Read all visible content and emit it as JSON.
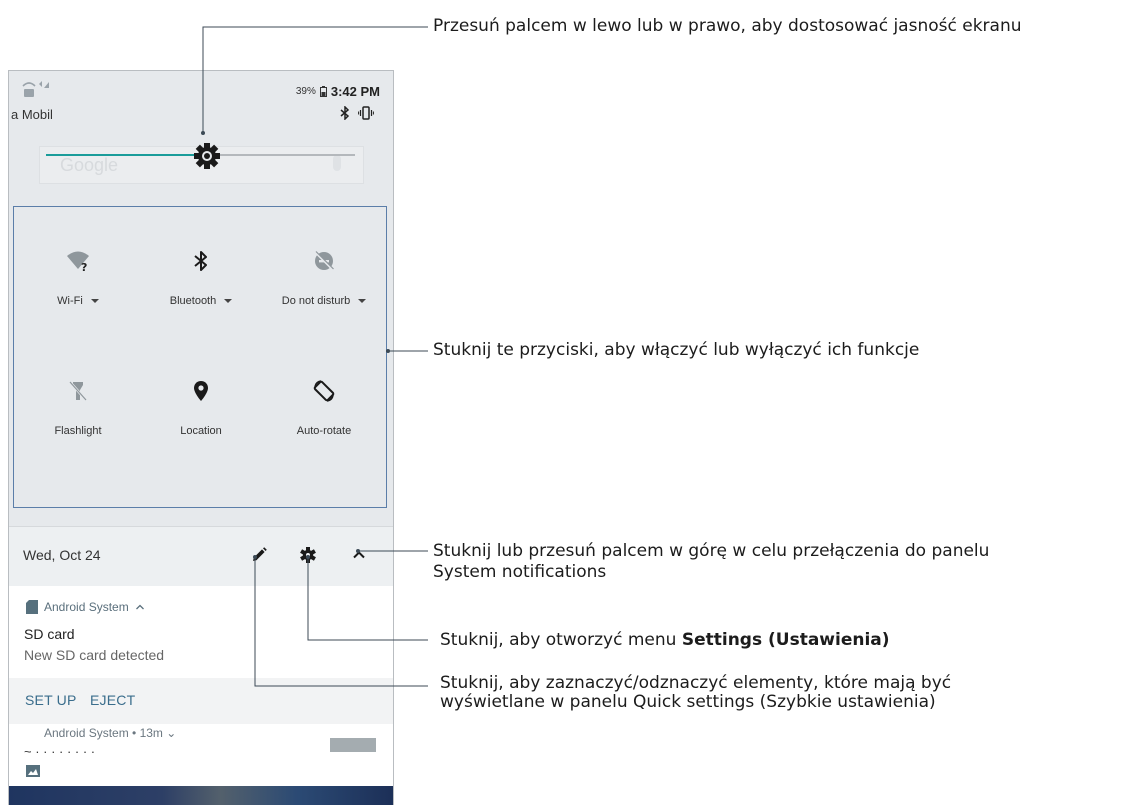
{
  "status_bar": {
    "carrier": "a Mobil",
    "battery": "39%",
    "time": "3:42 PM"
  },
  "search": {
    "ghost_text": "Google"
  },
  "brightness": {
    "level": 0.52
  },
  "quick_settings": {
    "tiles": [
      {
        "label": "Wi-Fi",
        "icon": "wifi-question-icon",
        "has_menu": true
      },
      {
        "label": "Bluetooth",
        "icon": "bluetooth-icon",
        "has_menu": true
      },
      {
        "label": "Do not disturb",
        "icon": "do-not-disturb-icon",
        "has_menu": true
      },
      {
        "label": "Flashlight",
        "icon": "flashlight-off-icon",
        "has_menu": false
      },
      {
        "label": "Location",
        "icon": "location-pin-icon",
        "has_menu": false
      },
      {
        "label": "Auto-rotate",
        "icon": "auto-rotate-icon",
        "has_menu": false
      }
    ],
    "pages": 2,
    "current_page": 1
  },
  "date_row": {
    "date": "Wed, Oct 24"
  },
  "notification": {
    "app": "Android System",
    "title": "SD card",
    "body": "New SD card detected",
    "actions": [
      "SET UP",
      "EJECT"
    ]
  },
  "notification2": {
    "app": "Android System • 13m"
  },
  "callouts": {
    "brightness": "Przesuń palcem w lewo lub w prawo, aby dostosować jasność ekranu",
    "toggles": "Stuknij te przyciski, aby włączyć lub wyłączyć ich funkcje",
    "expand_line1": "Stuknij lub przesuń palcem w górę w celu przełączenia do panelu",
    "expand_line2": "System notifications",
    "settings_prefix": "Stuknij, aby otworzyć menu ",
    "settings_bold": "Settings (Ustawienia)",
    "edit_line1": "Stuknij, aby zaznaczyć/odznaczyć elementy, które mają być",
    "edit_line2": "wyświetlane w panelu Quick settings (Szybkie ustawienia)"
  },
  "colors": {
    "accent": "#1a9c9a",
    "callout_line": "#3c4a56",
    "qs_border": "#5b7ea9",
    "action_text": "#3a6d8c"
  }
}
